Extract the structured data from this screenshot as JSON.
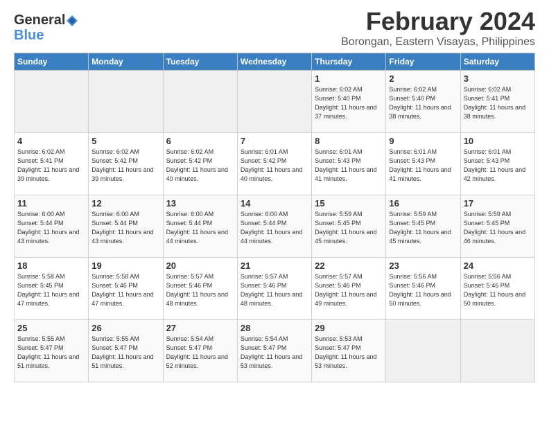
{
  "header": {
    "logo_line1": "General",
    "logo_line2": "Blue",
    "month_year": "February 2024",
    "location": "Borongan, Eastern Visayas, Philippines"
  },
  "calendar": {
    "days_of_week": [
      "Sunday",
      "Monday",
      "Tuesday",
      "Wednesday",
      "Thursday",
      "Friday",
      "Saturday"
    ],
    "weeks": [
      [
        {
          "day": "",
          "info": ""
        },
        {
          "day": "",
          "info": ""
        },
        {
          "day": "",
          "info": ""
        },
        {
          "day": "",
          "info": ""
        },
        {
          "day": "1",
          "info": "Sunrise: 6:02 AM\nSunset: 5:40 PM\nDaylight: 11 hours\nand 37 minutes."
        },
        {
          "day": "2",
          "info": "Sunrise: 6:02 AM\nSunset: 5:40 PM\nDaylight: 11 hours\nand 38 minutes."
        },
        {
          "day": "3",
          "info": "Sunrise: 6:02 AM\nSunset: 5:41 PM\nDaylight: 11 hours\nand 38 minutes."
        }
      ],
      [
        {
          "day": "4",
          "info": "Sunrise: 6:02 AM\nSunset: 5:41 PM\nDaylight: 11 hours\nand 39 minutes."
        },
        {
          "day": "5",
          "info": "Sunrise: 6:02 AM\nSunset: 5:42 PM\nDaylight: 11 hours\nand 39 minutes."
        },
        {
          "day": "6",
          "info": "Sunrise: 6:02 AM\nSunset: 5:42 PM\nDaylight: 11 hours\nand 40 minutes."
        },
        {
          "day": "7",
          "info": "Sunrise: 6:01 AM\nSunset: 5:42 PM\nDaylight: 11 hours\nand 40 minutes."
        },
        {
          "day": "8",
          "info": "Sunrise: 6:01 AM\nSunset: 5:43 PM\nDaylight: 11 hours\nand 41 minutes."
        },
        {
          "day": "9",
          "info": "Sunrise: 6:01 AM\nSunset: 5:43 PM\nDaylight: 11 hours\nand 41 minutes."
        },
        {
          "day": "10",
          "info": "Sunrise: 6:01 AM\nSunset: 5:43 PM\nDaylight: 11 hours\nand 42 minutes."
        }
      ],
      [
        {
          "day": "11",
          "info": "Sunrise: 6:00 AM\nSunset: 5:44 PM\nDaylight: 11 hours\nand 43 minutes."
        },
        {
          "day": "12",
          "info": "Sunrise: 6:00 AM\nSunset: 5:44 PM\nDaylight: 11 hours\nand 43 minutes."
        },
        {
          "day": "13",
          "info": "Sunrise: 6:00 AM\nSunset: 5:44 PM\nDaylight: 11 hours\nand 44 minutes."
        },
        {
          "day": "14",
          "info": "Sunrise: 6:00 AM\nSunset: 5:44 PM\nDaylight: 11 hours\nand 44 minutes."
        },
        {
          "day": "15",
          "info": "Sunrise: 5:59 AM\nSunset: 5:45 PM\nDaylight: 11 hours\nand 45 minutes."
        },
        {
          "day": "16",
          "info": "Sunrise: 5:59 AM\nSunset: 5:45 PM\nDaylight: 11 hours\nand 45 minutes."
        },
        {
          "day": "17",
          "info": "Sunrise: 5:59 AM\nSunset: 5:45 PM\nDaylight: 11 hours\nand 46 minutes."
        }
      ],
      [
        {
          "day": "18",
          "info": "Sunrise: 5:58 AM\nSunset: 5:45 PM\nDaylight: 11 hours\nand 47 minutes."
        },
        {
          "day": "19",
          "info": "Sunrise: 5:58 AM\nSunset: 5:46 PM\nDaylight: 11 hours\nand 47 minutes."
        },
        {
          "day": "20",
          "info": "Sunrise: 5:57 AM\nSunset: 5:46 PM\nDaylight: 11 hours\nand 48 minutes."
        },
        {
          "day": "21",
          "info": "Sunrise: 5:57 AM\nSunset: 5:46 PM\nDaylight: 11 hours\nand 48 minutes."
        },
        {
          "day": "22",
          "info": "Sunrise: 5:57 AM\nSunset: 5:46 PM\nDaylight: 11 hours\nand 49 minutes."
        },
        {
          "day": "23",
          "info": "Sunrise: 5:56 AM\nSunset: 5:46 PM\nDaylight: 11 hours\nand 50 minutes."
        },
        {
          "day": "24",
          "info": "Sunrise: 5:56 AM\nSunset: 5:46 PM\nDaylight: 11 hours\nand 50 minutes."
        }
      ],
      [
        {
          "day": "25",
          "info": "Sunrise: 5:55 AM\nSunset: 5:47 PM\nDaylight: 11 hours\nand 51 minutes."
        },
        {
          "day": "26",
          "info": "Sunrise: 5:55 AM\nSunset: 5:47 PM\nDaylight: 11 hours\nand 51 minutes."
        },
        {
          "day": "27",
          "info": "Sunrise: 5:54 AM\nSunset: 5:47 PM\nDaylight: 11 hours\nand 52 minutes."
        },
        {
          "day": "28",
          "info": "Sunrise: 5:54 AM\nSunset: 5:47 PM\nDaylight: 11 hours\nand 53 minutes."
        },
        {
          "day": "29",
          "info": "Sunrise: 5:53 AM\nSunset: 5:47 PM\nDaylight: 11 hours\nand 53 minutes."
        },
        {
          "day": "",
          "info": ""
        },
        {
          "day": "",
          "info": ""
        }
      ]
    ]
  }
}
